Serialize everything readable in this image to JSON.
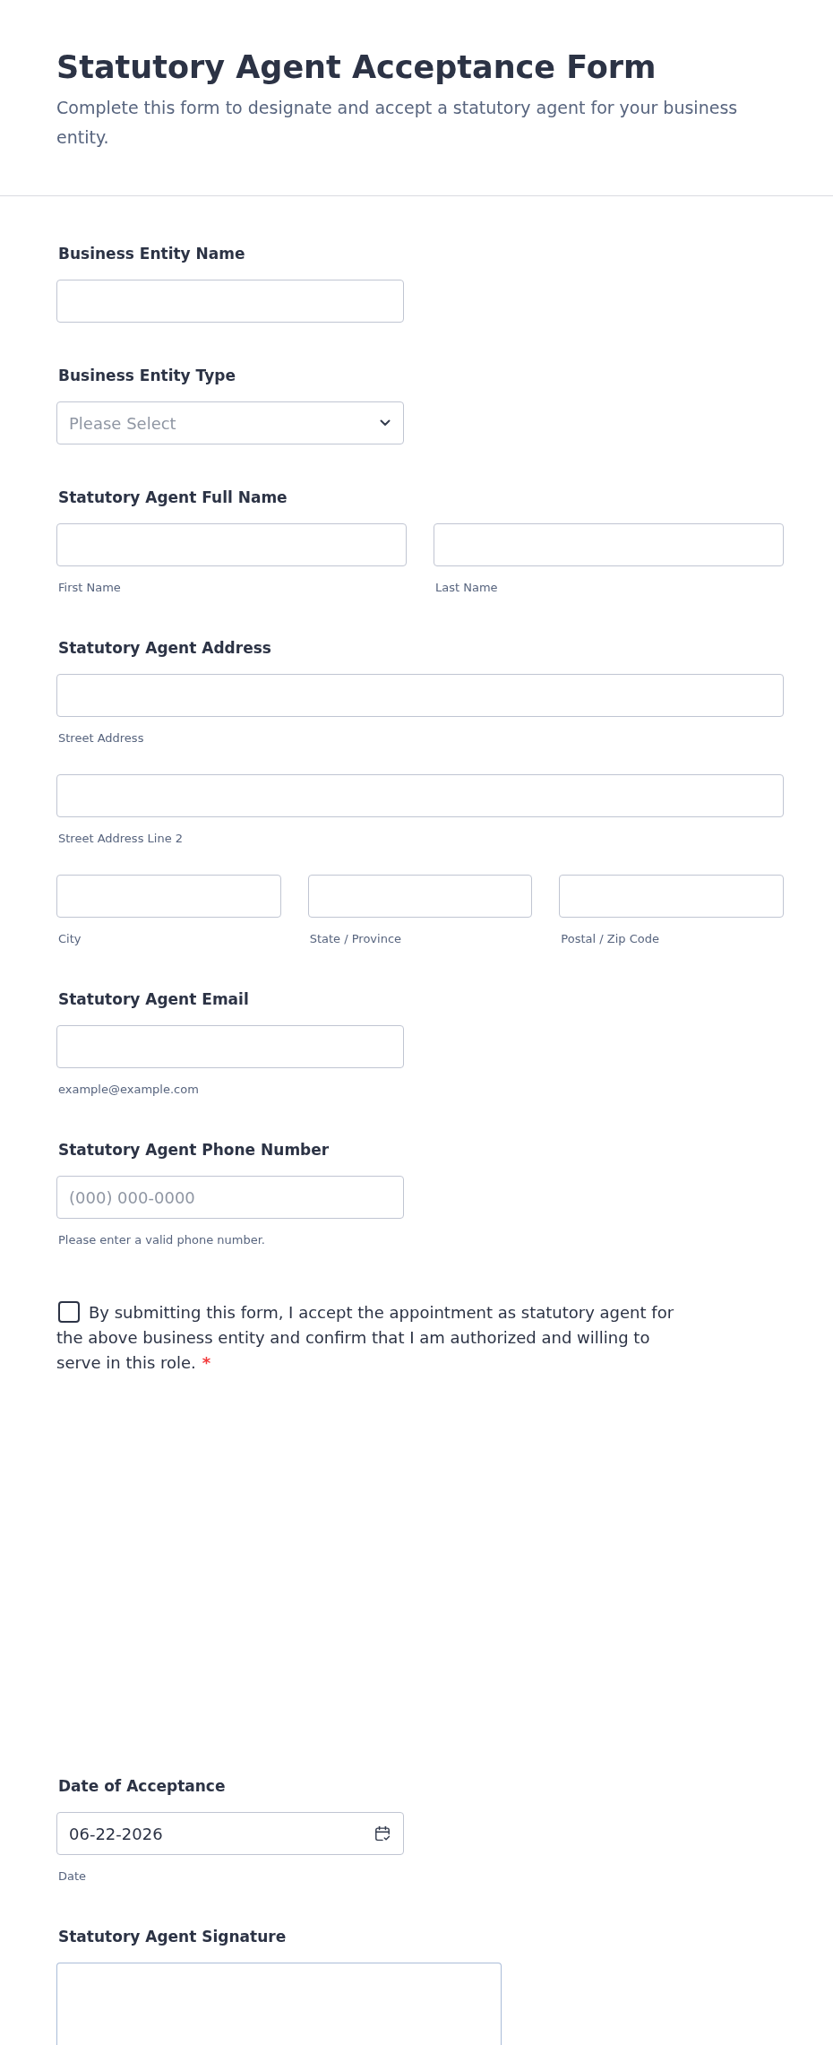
{
  "header": {
    "title": "Statutory Agent Acceptance Form",
    "description": "Complete this form to designate and accept a statutory agent for your business entity."
  },
  "fields": [
    {
      "kind": "text",
      "label": "Business Entity Name"
    },
    {
      "kind": "dropdown",
      "label": "Business Entity Type",
      "placeholder": "Please Select"
    },
    {
      "kind": "group",
      "label": "Statutory Agent Full Name",
      "rows": [
        {
          "inputs": [
            {
              "sublabel": "First Name"
            },
            {
              "sublabel": "Last Name"
            }
          ]
        }
      ]
    },
    {
      "kind": "group",
      "label": "Statutory Agent Address",
      "rows": [
        {
          "inputs": [
            {
              "sublabel": "Street Address"
            }
          ]
        },
        {
          "inputs": [
            {
              "sublabel": "Street Address Line 2"
            }
          ]
        },
        {
          "inputs": [
            {
              "sublabel": "City"
            },
            {
              "sublabel": "State / Province"
            },
            {
              "sublabel": "Postal / Zip Code"
            }
          ]
        }
      ]
    },
    {
      "kind": "text",
      "label": "Statutory Agent Email",
      "sublabel": "example@example.com"
    },
    {
      "kind": "text",
      "label": "Statutory Agent Phone Number",
      "placeholder": "(000) 000-0000",
      "sublabel": "Please enter a valid phone number."
    },
    {
      "kind": "checkbox",
      "text": "By submitting this form, I accept the appointment as statutory agent for the above business entity and confirm that I am authorized and willing to serve in this role.",
      "checked": false,
      "required_mark": "*"
    },
    {
      "kind": "date",
      "label": "Date of Acceptance",
      "value": "06-22-2026",
      "sublabel": "Date"
    },
    {
      "kind": "signature",
      "label": "Statutory Agent Signature"
    }
  ]
}
